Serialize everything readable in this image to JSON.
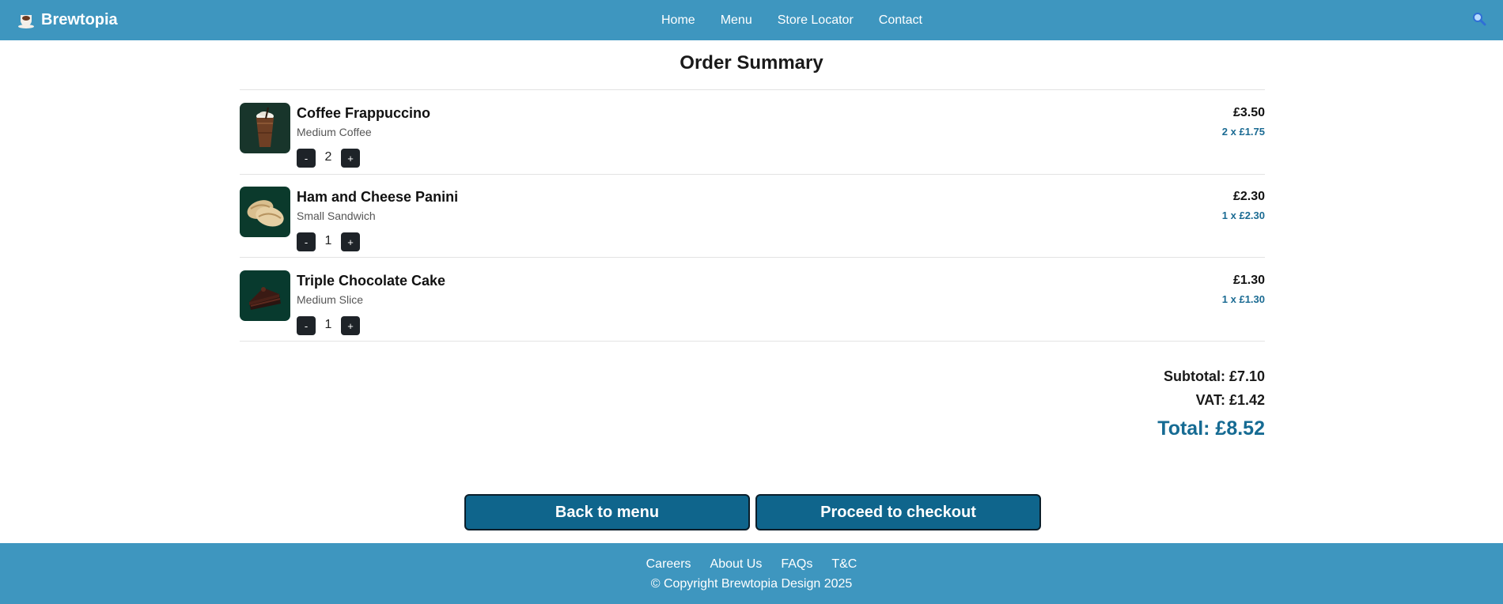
{
  "header": {
    "brand": "Brewtopia",
    "nav": [
      "Home",
      "Menu",
      "Store Locator",
      "Contact"
    ]
  },
  "main": {
    "title": "Order Summary",
    "items": [
      {
        "name": "Coffee Frappuccino",
        "variant": "Medium Coffee",
        "qty": "2",
        "price": "£3.50",
        "unit": "2 x £1.75",
        "minus": "-",
        "plus": "+"
      },
      {
        "name": "Ham and Cheese Panini",
        "variant": "Small Sandwich",
        "qty": "1",
        "price": "£2.30",
        "unit": "1 x £2.30",
        "minus": "-",
        "plus": "+"
      },
      {
        "name": "Triple Chocolate Cake",
        "variant": "Medium Slice",
        "qty": "1",
        "price": "£1.30",
        "unit": "1 x £1.30",
        "minus": "-",
        "plus": "+"
      }
    ],
    "subtotal": "Subtotal: £7.10",
    "vat": "VAT: £1.42",
    "total": "Total: £8.52",
    "back_label": "Back to menu",
    "checkout_label": "Proceed to checkout"
  },
  "footer": {
    "links": [
      "Careers",
      "About Us",
      "FAQs",
      "T&C"
    ],
    "copyright": "© Copyright Brewtopia Design 2025"
  },
  "colors": {
    "header_bg": "#3e96bf",
    "button_bg": "#0f658c",
    "accent_text": "#166b93"
  }
}
